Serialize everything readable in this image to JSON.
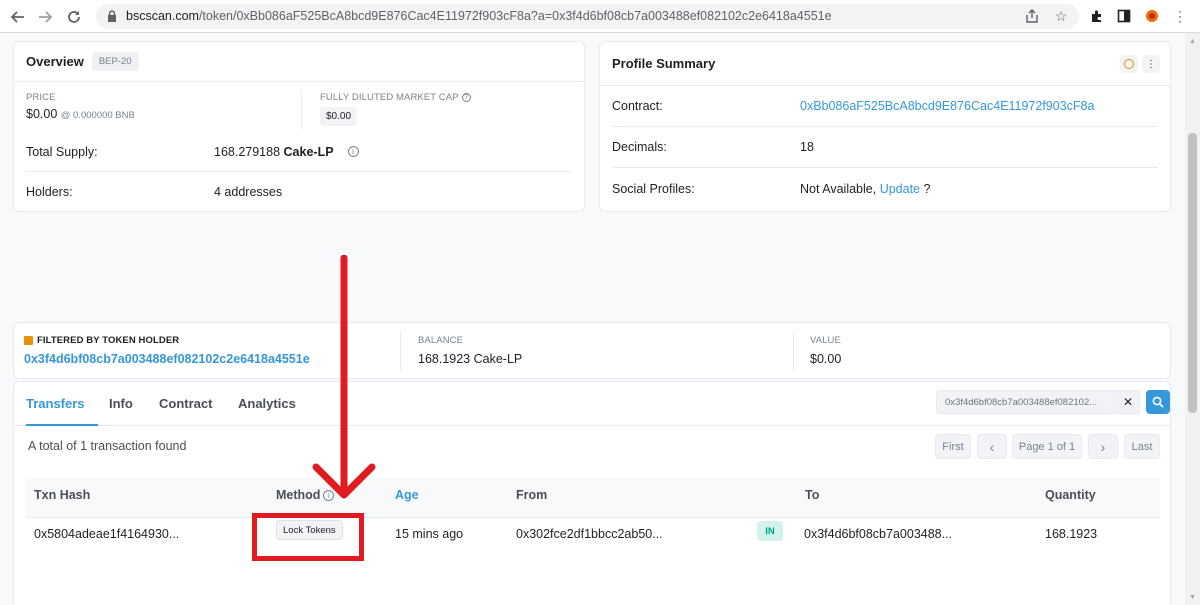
{
  "browser": {
    "url_host": "bscscan.com",
    "url_path": "/token/0xBb086aF525BcA8bcd9E876Cac4E11972f903cF8a?a=0x3f4d6bf08cb7a003488ef082102c2e6418a4551e",
    "icons": [
      "back-icon",
      "forward-icon",
      "reload-icon",
      "lock-icon",
      "share-icon",
      "star-icon",
      "extensions-icon",
      "sidepanel-icon",
      "profile-icon",
      "menu-icon"
    ]
  },
  "overview": {
    "title": "Overview",
    "badge": "BEP-20",
    "price_label": "PRICE",
    "price_value": "$0.00",
    "price_bnb": "@ 0.000000 BNB",
    "mcap_label": "FULLY DILUTED MARKET CAP",
    "mcap_value": "$0.00",
    "total_supply_label": "Total Supply:",
    "total_supply_amount": "168.279188",
    "total_supply_symbol": "Cake-LP",
    "holders_label": "Holders:",
    "holders_value": "4 addresses"
  },
  "profile": {
    "title": "Profile Summary",
    "contract_label": "Contract:",
    "contract_value": "0xBb086aF525BcA8bcd9E876Cac4E11972f903cF8a",
    "decimals_label": "Decimals:",
    "decimals_value": "18",
    "social_label": "Social Profiles:",
    "social_value": "Not Available,",
    "social_update": "Update",
    "social_q": "?"
  },
  "filter": {
    "label": "FILTERED BY TOKEN HOLDER",
    "address": "0x3f4d6bf08cb7a003488ef082102c2e6418a4551e",
    "balance_label": "BALANCE",
    "balance_value": "168.1923 Cake-LP",
    "value_label": "VALUE",
    "value_value": "$0.00"
  },
  "tabs": {
    "transfers": "Transfers",
    "info": "Info",
    "contract": "Contract",
    "analytics": "Analytics",
    "filter_text": "0x3f4d6bf08cb7a003488ef082102..."
  },
  "table": {
    "summary": "A total of 1 transaction found",
    "pager": {
      "first": "First",
      "prev": "‹",
      "page": "Page 1 of 1",
      "next": "›",
      "last": "Last"
    },
    "headers": {
      "hash": "Txn Hash",
      "method": "Method",
      "age": "Age",
      "from": "From",
      "to": "To",
      "quantity": "Quantity"
    },
    "row": {
      "hash": "0x5804adeae1f4164930...",
      "method": "Lock Tokens",
      "age": "15 mins ago",
      "from": "0x302fce2df1bbcc2ab50...",
      "direction": "IN",
      "to": "0x3f4d6bf08cb7a003488...",
      "quantity": "168.1923"
    }
  },
  "colors": {
    "link": "#3498db",
    "annotation": "#e21b23",
    "in_badge": "#00a186"
  }
}
